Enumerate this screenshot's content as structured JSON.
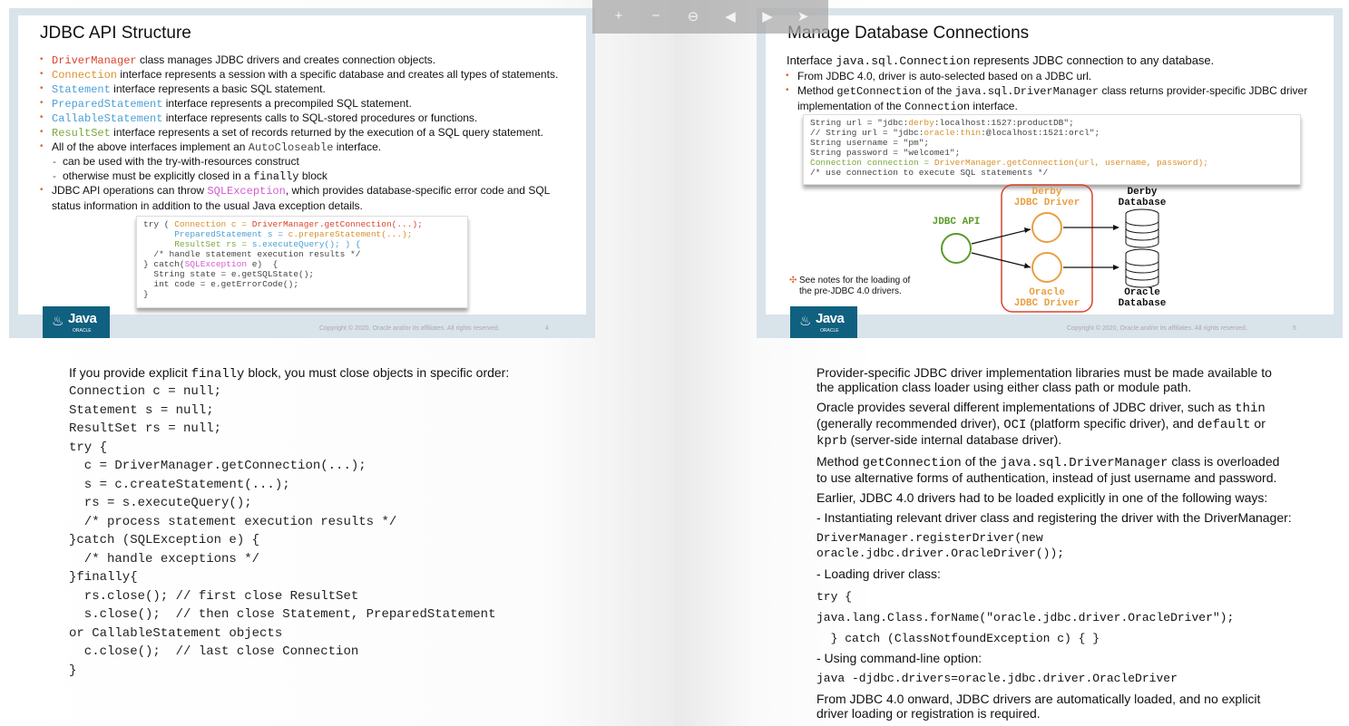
{
  "toolbar": {
    "zoom_in": "+",
    "zoom_out": "−",
    "zoom_reset": "⊖",
    "prev": "◀",
    "next": "▶",
    "cursor": "➤"
  },
  "slide4": {
    "title": "JDBC API Structure",
    "b1_code": "DriverManager",
    "b1_text": " class manages JDBC drivers and creates connection objects.",
    "b2_code": "Connection",
    "b2_text": " interface represents a session with a specific database and creates all types of statements.",
    "b3_code": "Statement",
    "b3_text": " interface represents a basic SQL statement.",
    "b4_code": "PreparedStatement",
    "b4_text": " interface represents a precompiled SQL statement.",
    "b5_code": "CallableStatement",
    "b5_text": " interface represents calls to SQL-stored procedures or functions.",
    "b6_code": "ResultSet",
    "b6_text": " interface represents a set of records returned by the execution of a SQL query statement.",
    "b7_text": "All of the above interfaces implement an ",
    "b7_code": "AutoCloseable",
    "b7_end": " interface.",
    "s1": "can be used with the try-with-resources construct",
    "s2_text": "otherwise must be explicitly closed in a ",
    "s2_code": "finally",
    "s2_end": " block",
    "b8_text": "JDBC API operations can throw ",
    "b8_code": "SQLException",
    "b8_end": ", which provides database-specific error code and SQL",
    "b8_line2": "status information in addition to the usual Java exception details.",
    "code_l1a": "try ( ",
    "code_l1b": "Connection c = ",
    "code_l1c": "DriverManager.getConnection(...);",
    "code_l2a": "      ",
    "code_l2b": "PreparedStatement s = ",
    "code_l2c": "c.prepareStatement(...);",
    "code_l3a": "      ",
    "code_l3b": "ResultSet rs = ",
    "code_l3c": "s.executeQuery(); ) {",
    "code_l4": "  /* handle statement execution results */",
    "code_l5a": "} catch(",
    "code_l5b": "SQLException",
    "code_l5c": " e)  {",
    "code_l6": "  String state = e.getSQLState();",
    "code_l7": "  int code = e.getErrorCode();",
    "code_l8": "}",
    "copyright": "Copyright © 2020, Oracle and/or its affiliates. All rights reserved.",
    "page": "4",
    "logo_java": "Java",
    "logo_oracle": "ORACLE"
  },
  "slide5": {
    "title": "Manage Database Connections",
    "intro_a": "Interface ",
    "intro_code": "java.sql.Connection",
    "intro_b": " represents JDBC connection to any database.",
    "b1": "From JDBC 4.0, driver is auto-selected based on a JDBC url.",
    "b2_a": "Method ",
    "b2_code1": "getConnection",
    "b2_b": " of the ",
    "b2_code2": "java.sql.DriverManager",
    "b2_c": " class returns provider-specific JDBC driver",
    "b2_line2a": "implementation of the ",
    "b2_line2code": "Connection",
    "b2_line2b": " interface.",
    "code_l1a": "String url = \"jdbc:",
    "code_l1b": "derby",
    "code_l1c": ":localhost:1527:productDB\";",
    "code_l2a": "// String url = \"jdbc:",
    "code_l2b": "oracle:thin",
    "code_l2c": ":@localhost:1521:orcl\";",
    "code_l3": "String username = \"pm\";",
    "code_l4": "String password = \"welcome1\";",
    "code_l5a": "Connection connection = ",
    "code_l5b": "DriverManager.getConnection(url, username, password);",
    "code_l6": "/* use connection to execute SQL statements */",
    "jdbc_api": "JDBC API",
    "derby_driver_1": "Derby",
    "derby_driver_2": "JDBC Driver",
    "oracle_driver_1": "Oracle",
    "oracle_driver_2": "JDBC Driver",
    "derby_db_1": "Derby",
    "derby_db_2": "Database",
    "oracle_db_1": "Oracle",
    "oracle_db_2": "Database",
    "note_mark": "✣",
    "note_1": "See notes for the loading of",
    "note_2": "the pre-JDBC 4.0 drivers.",
    "copyright": "Copyright © 2020, Oracle and/or its affiliates. All rights reserved.",
    "page": "5",
    "logo_java": "Java",
    "logo_oracle": "ORACLE"
  },
  "notes_left": {
    "intro_a": "If you provide explicit ",
    "intro_code": "finally",
    "intro_b": " block, you must close objects in specific order:",
    "code": "Connection c = null;\nStatement s = null;\nResultSet rs = null;\ntry {\n  c = DriverManager.getConnection(...);\n  s = c.createStatement(...);\n  rs = s.executeQuery();\n  /* process statement execution results */\n}catch (SQLException e) {\n  /* handle exceptions */\n}finally{\n  rs.close(); // first close ResultSet\n  s.close();  // then close Statement, PreparedStatement\nor CallableStatement objects\n  c.close();  // last close Connection\n}"
  },
  "notes_right": {
    "p1": "Provider-specific JDBC driver implementation libraries must be made available to the application class loader using either class path or module path.",
    "p2_a": "Oracle provides several different implementations of JDBC driver, such as ",
    "p2_c1": "thin",
    "p2_b": " (generally recommended driver), ",
    "p2_c2": "OCI",
    "p2_c": " (platform specific driver), and ",
    "p2_c3": "default",
    "p2_d": " or ",
    "p2_c4": "kprb",
    "p2_e": " (server-side internal database driver).",
    "p3_a": "Method ",
    "p3_c1": "getConnection",
    "p3_b": " of the ",
    "p3_c2": "java.sql.DriverManager",
    "p3_c": " class is overloaded to use alternative forms of authentication, instead of just username and password.",
    "p4": "Earlier, JDBC 4.0 drivers had to be loaded explicitly in one of the following ways:",
    "p5": "- Instantiating relevant driver class and registering the driver with the DriverManager:",
    "code1": "DriverManager.registerDriver(new\noracle.jdbc.driver.OracleDriver());",
    "p6": "-  Loading driver class:",
    "code2a": "try {",
    "code2b": "java.lang.Class.forName(\"oracle.jdbc.driver.OracleDriver\");",
    "code2c": "  } catch (ClassNotfoundException c) { }",
    "p7": "- Using command-line option:",
    "code3": "java -djdbc.drivers=oracle.jdbc.driver.OracleDriver",
    "p8": "From JDBC 4.0 onward, JDBC drivers are automatically loaded, and no explicit driver loading or registration is required."
  }
}
